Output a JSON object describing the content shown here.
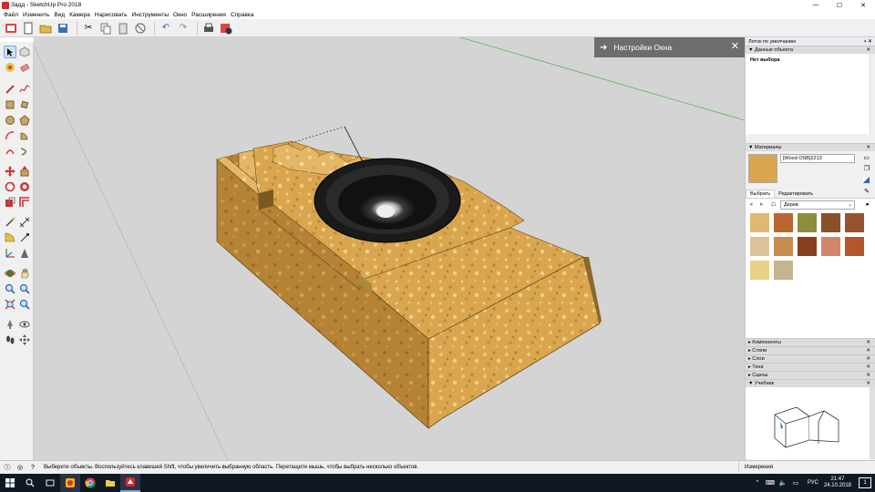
{
  "window": {
    "title": "Задд - SketchUp Pro 2018",
    "minimize": "—",
    "maximize": "☐",
    "close": "✕"
  },
  "menu": [
    "Файл",
    "Изменить",
    "Вид",
    "Камера",
    "Нарисовать",
    "Инструменты",
    "Окно",
    "Расширения",
    "Справка"
  ],
  "viewport": {
    "overlay_title": "Настройки Окна",
    "overlay_arrow": "➜",
    "overlay_close": "✕"
  },
  "tray": {
    "title": "Лоток по умолчанию",
    "entity_info": {
      "header": "Данные объекта",
      "body": "Нет выбора"
    },
    "materials": {
      "header": "Материалы",
      "material_name": "[Wood OSB]2213",
      "tab_select": "Выбрать",
      "tab_edit": "Редактировать",
      "library": "Дерев",
      "swatches": [
        "#e1b873",
        "#b9662f",
        "#8e8d3a",
        "#8a5027",
        "#96532c",
        "#dcc29a",
        "#c58b4f",
        "#873f1e",
        "#d28667",
        "#b1572b",
        "#e8d184",
        "#c6b48e"
      ]
    },
    "collapsed_sections": [
      "Компоненты",
      "Стили",
      "Слои",
      "Тени",
      "Сцены"
    ],
    "instructor": {
      "header": "Учебник"
    }
  },
  "status": {
    "message": "Выберите объекты. Воспользуйтесь клавишей Shift, чтобы увеличить выбранную область. Перетащите мышь, чтобы выбрать несколько объектов.",
    "measurements_label": "Измерения",
    "info_icon": "ⓘ",
    "help_icon": "?"
  },
  "taskbar": {
    "lang": "РУС",
    "time": "21:47",
    "date": "24.10.2018",
    "notif": "1"
  },
  "colors": {
    "viewport_bg": "#d4d4d4",
    "osb": "#d9a64f",
    "speaker": "#1a1a1a",
    "overlay_bg": "#6d6d6d",
    "taskbar_bg": "#101825",
    "sketchup_red": "#c8302a"
  }
}
